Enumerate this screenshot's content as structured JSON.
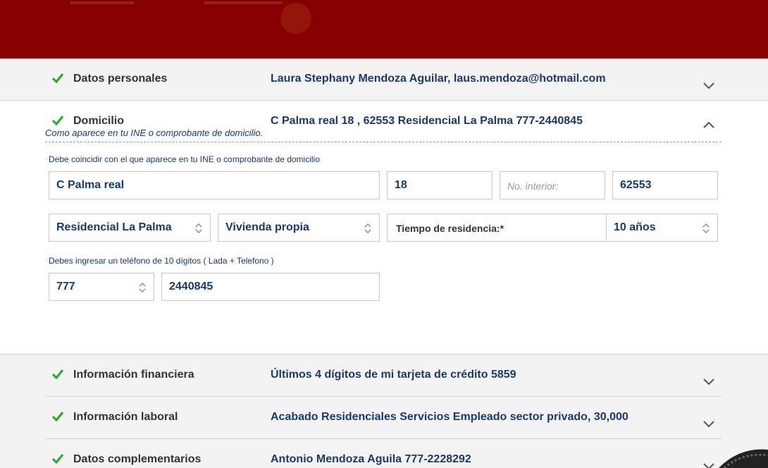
{
  "sections": [
    {
      "label": "Datos personales",
      "summary": "Laura Stephany Mendoza Aguilar, laus.mendoza@hotmail.com"
    },
    {
      "label": "Domicilio",
      "summary": "C Palma real 18 , 62553 Residencial La Palma 777-2440845"
    },
    {
      "label": "Información financiera",
      "summary": "Últimos 4 dígitos de mi tarjeta de crédito 5859"
    },
    {
      "label": "Información laboral",
      "summary": "Acabado Residenciales Servicios Empleado sector privado, 30,000"
    },
    {
      "label": "Datos complementarios",
      "summary": "Antonio Mendoza Aguila 777-2228292"
    }
  ],
  "domicilio": {
    "hint_ine": "Como aparece en tu INE o comprobante de domicilio.",
    "hint_match": "Debe coincidir con el que aparece en tu INE o comprobante de domicilio",
    "street": "C Palma real",
    "ext_number": "18",
    "int_number_placeholder": "No. interior:",
    "zip": "62553",
    "colonia": "Residencial La Palma",
    "housing_type": "Vivienda propia",
    "residence_time_label": "Tiempo de residencia:*",
    "residence_time": "10 años",
    "phone_hint": "Debes ingresar un teléfono de 10 dígitos ( Lada + Telefono )",
    "lada": "777",
    "phone": "2440845"
  },
  "colors": {
    "topbar": "#870000",
    "accent_text": "#1a3a6b",
    "check": "#2aa82a"
  },
  "icons": [
    "check-icon",
    "chevron-down-icon",
    "chevron-up-icon",
    "select-updown-icon"
  ]
}
